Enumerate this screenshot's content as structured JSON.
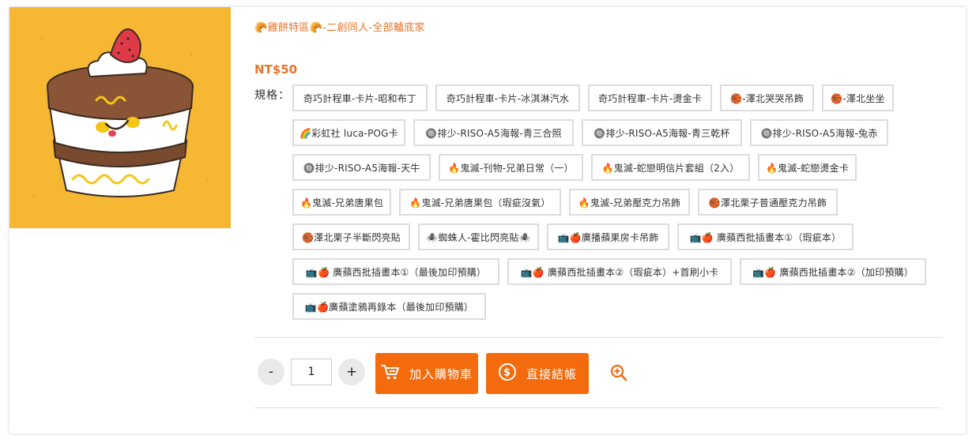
{
  "product": {
    "title": "🥐雞餅特區🥐-二創同人-全部轤底家",
    "price": "NT$50",
    "spec_label": "規格：",
    "image_alt": "cake-illustration"
  },
  "options": [
    "奇巧計程車-卡片-昭和布丁",
    "奇巧計程車-卡片-冰淇淋汽水",
    "奇巧計程車-卡片-燙金卡",
    "🏀-澤北哭哭吊飾",
    "🏀-澤北坐坐",
    "🌈彩虹社 luca-POG卡",
    "🔘排少-RISO-A5海報-青三合照",
    "🔘排少-RISO-A5海報-青三乾杯",
    "🔘排少-RISO-A5海報-兔赤",
    "🔘排少-RISO-A5海報-天牛",
    "🔥鬼滅-刊物-兄弟日常（一）",
    "🔥鬼滅-蛇戀明信片套組（2入）",
    "🔥鬼滅-蛇戀燙金卡",
    "🔥鬼滅-兄弟唐果包",
    "🔥鬼滅-兄弟唐果包（瑕疵沒氣）",
    "🔥鬼滅-兄弟壓克力吊飾",
    "🏀澤北栗子普通壓克力吊飾",
    "🏀澤北栗子半斷閃亮貼",
    "🕷️蜘蛛人-霍比閃亮貼🕷️",
    "📺🍎廣播蘋果房卡吊飾",
    "📺🍎 廣蘋西批插畫本①（瑕疵本）",
    "📺🍎 廣蘋西批插畫本①（最後加印預購）",
    "📺🍎 廣蘋西批插畫本②（瑕疵本）+首刷小卡",
    "📺🍎 廣蘋西批插畫本②（加印預購）",
    "📺🍎廣蘋塗鴉再錄本（最後加印預購）"
  ],
  "quantity": {
    "minus": "-",
    "value": "1",
    "plus": "+"
  },
  "actions": {
    "add_to_cart": "加入購物車",
    "checkout": "直接結帳"
  },
  "colors": {
    "accent": "#f36b0d",
    "title": "#e8742a",
    "image_bg": "#f6b833"
  },
  "icons": {
    "cart": "cart-icon",
    "checkout": "dollar-coin-icon",
    "zoom": "zoom-in-icon"
  }
}
